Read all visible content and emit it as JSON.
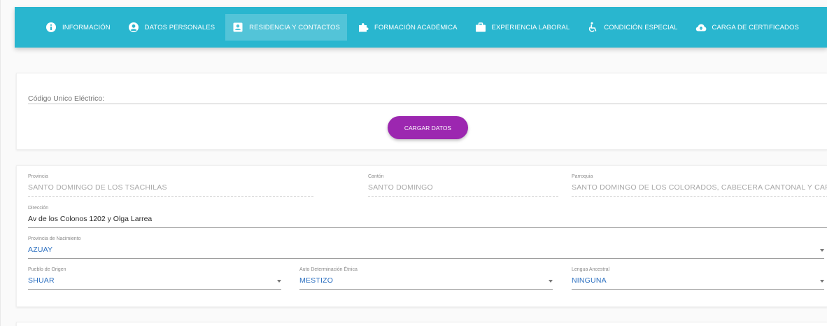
{
  "tabs": [
    {
      "label": "Información",
      "icon": "info-icon",
      "active": false
    },
    {
      "label": "Datos Personales",
      "icon": "account-circle-icon",
      "active": false
    },
    {
      "label": "Residencia y Contactos",
      "icon": "contact-card-icon",
      "active": true
    },
    {
      "label": "Formación Académica",
      "icon": "puzzle-icon",
      "active": false
    },
    {
      "label": "Experiencia Laboral",
      "icon": "briefcase-icon",
      "active": false
    },
    {
      "label": "Condición Especial",
      "icon": "wheelchair-icon",
      "active": false
    },
    {
      "label": "Carga de Certificados",
      "icon": "cloud-upload-icon",
      "active": false
    }
  ],
  "cue": {
    "label": "Código Unico Eléctrico:",
    "button": "Cargar Datos"
  },
  "residence": {
    "provincia": {
      "label": "Provincia",
      "value": "SANTO DOMINGO DE LOS TSACHILAS"
    },
    "canton": {
      "label": "Cantón",
      "value": "SANTO DOMINGO"
    },
    "parroquia": {
      "label": "Parroquia",
      "value": "SANTO DOMINGO DE LOS COLORADOS, CABECERA CANTONAL Y CAPITAL"
    },
    "direccion": {
      "label": "Dirección",
      "value": "Av de los Colonos 1202 y Olga Larrea"
    },
    "provincia_nacimiento": {
      "label": "Provincia de Nacimiento",
      "value": "AZUAY"
    },
    "pueblo_origen": {
      "label": "Pueblo de Origen",
      "value": "SHUAR"
    },
    "auto_determinacion": {
      "label": "Auto Determinación Étnica",
      "value": "MESTIZO"
    },
    "lengua_ancestral": {
      "label": "Lengua Ancestral",
      "value": "NINGUNA"
    }
  },
  "colors": {
    "tabbar": "#29b6cf",
    "button": "#9c27b0",
    "select_value": "#2b6fc0"
  }
}
